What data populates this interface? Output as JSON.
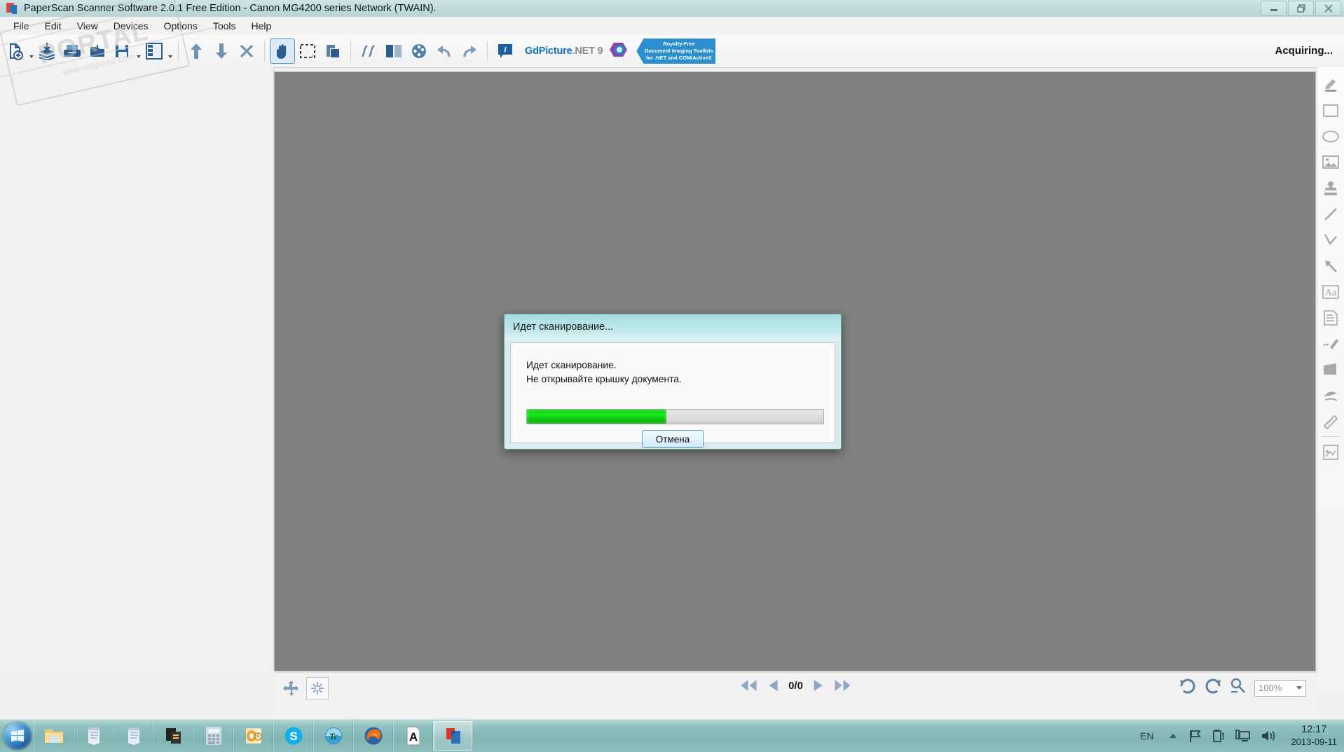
{
  "window": {
    "title": "PaperScan Scanner Software 2.0.1 Free Edition - Canon MG4200 series Network (TWAIN).",
    "app_icon": "paperscan-icon",
    "controls": {
      "minimize": "minimize-button",
      "restore": "restore-button",
      "close": "close-button"
    }
  },
  "menubar": {
    "items": [
      {
        "label": "File"
      },
      {
        "label": "Edit"
      },
      {
        "label": "View"
      },
      {
        "label": "Devices"
      },
      {
        "label": "Options"
      },
      {
        "label": "Tools"
      },
      {
        "label": "Help"
      }
    ]
  },
  "toolbar": {
    "buttons": [
      {
        "name": "new-document-icon",
        "has_caret": true
      },
      {
        "name": "acquire-batch-icon",
        "has_caret": false
      },
      {
        "name": "scanner-settings-icon",
        "has_caret": false
      },
      {
        "name": "import-file-icon",
        "has_caret": false
      },
      {
        "name": "save-document-icon",
        "has_caret": true
      },
      {
        "name": "thumbnail-panel-icon",
        "has_caret": true
      },
      {
        "name": "move-up-icon",
        "has_caret": false
      },
      {
        "name": "move-down-icon",
        "has_caret": false
      },
      {
        "name": "delete-page-icon",
        "has_caret": false
      },
      {
        "name": "pan-hand-tool-icon",
        "has_caret": false,
        "selected": true
      },
      {
        "name": "rectangle-select-tool-icon",
        "has_caret": false
      },
      {
        "name": "crop-tool-icon",
        "has_caret": false
      },
      {
        "name": "deskew-icon",
        "has_caret": false
      },
      {
        "name": "color-detection-icon",
        "has_caret": false
      },
      {
        "name": "color-palette-icon",
        "has_caret": false
      },
      {
        "name": "undo-icon",
        "has_caret": false
      },
      {
        "name": "redo-icon",
        "has_caret": false
      },
      {
        "name": "about-info-icon",
        "has_caret": false
      }
    ],
    "gdpicture": {
      "brand": "GdPicture",
      "brand_suffix": ".NET 9",
      "logo": "gdpicture-logo-icon",
      "banner_line1": "Royalty-Free",
      "banner_line2": "Document Imaging Toolkits",
      "banner_line3": "for .NET and COM/ActiveX",
      "banner_color": "#2b8fce",
      "brand_color": "#0f6fb5"
    },
    "status_right": "Acquiring..."
  },
  "annotation_tools": {
    "items": [
      {
        "name": "highlighter-tool-icon"
      },
      {
        "name": "rectangle-tool-icon"
      },
      {
        "name": "ellipse-tool-icon"
      },
      {
        "name": "embedded-image-tool-icon"
      },
      {
        "name": "rubber-stamp-tool-icon"
      },
      {
        "name": "line-tool-icon"
      },
      {
        "name": "polyline-tool-icon"
      },
      {
        "name": "arrow-tool-icon"
      },
      {
        "name": "text-tool-icon"
      },
      {
        "name": "sticky-note-tool-icon"
      },
      {
        "name": "freehand-tool-icon"
      },
      {
        "name": "polygon-tool-icon"
      },
      {
        "name": "ink-tool-icon"
      },
      {
        "name": "ruler-tool-icon"
      },
      {
        "name": "region-snapshot-tool-icon"
      }
    ]
  },
  "statusbar": {
    "fit_page_icon": "fit-page-icon",
    "fit_width_icon": "fit-actual-size-icon",
    "nav": {
      "first_icon": "first-page-icon",
      "prev_icon": "previous-page-icon",
      "page_counter": "0/0",
      "next_icon": "next-page-icon",
      "last_icon": "last-page-icon"
    },
    "rotate_left_icon": "rotate-left-icon",
    "rotate_right_icon": "rotate-right-icon",
    "zoom_icon": "zoom-magnifier-icon",
    "zoom_value": "100%"
  },
  "dialog": {
    "title": "Идет сканирование...",
    "message_line1": "Идет сканирование.",
    "message_line2": "Не открывайте крышку документа.",
    "progress_percent": 47,
    "cancel_label": "Отмена",
    "progress_color": "#19e619",
    "titlebar_color": "#a6dde2"
  },
  "watermark": {
    "text": "PORTAL",
    "subtext": "www.softportal.com"
  },
  "taskbar": {
    "start": "start-orb-icon",
    "items": [
      {
        "name": "taskbar-item-explorer",
        "icon": "folder-icon",
        "active": false
      },
      {
        "name": "taskbar-item-notepad-1",
        "icon": "notepad-icon",
        "active": false
      },
      {
        "name": "taskbar-item-notepad-2",
        "icon": "notepad-icon",
        "active": false
      },
      {
        "name": "taskbar-item-document",
        "icon": "document-icon",
        "active": false
      },
      {
        "name": "taskbar-item-calculator",
        "icon": "calculator-icon",
        "active": false
      },
      {
        "name": "taskbar-item-outlook",
        "icon": "outlook-icon",
        "active": false
      },
      {
        "name": "taskbar-item-skype",
        "icon": "skype-icon",
        "active": false
      },
      {
        "name": "taskbar-item-total-commander",
        "icon": "total-commander-icon",
        "active": false
      },
      {
        "name": "taskbar-item-firefox",
        "icon": "firefox-icon",
        "active": false
      },
      {
        "name": "taskbar-item-font-viewer",
        "icon": "letter-a-icon",
        "active": false
      },
      {
        "name": "taskbar-item-paperscan",
        "icon": "paperscan-icon",
        "active": true
      }
    ],
    "tray": {
      "language": "EN",
      "show_hidden_icon": "chevron-up-icon",
      "action_center_icon": "flag-icon",
      "battery_icon": "battery-icon",
      "network_icon": "network-icon",
      "volume_icon": "volume-icon",
      "time": "12:17",
      "date": "2013-09-11"
    }
  }
}
